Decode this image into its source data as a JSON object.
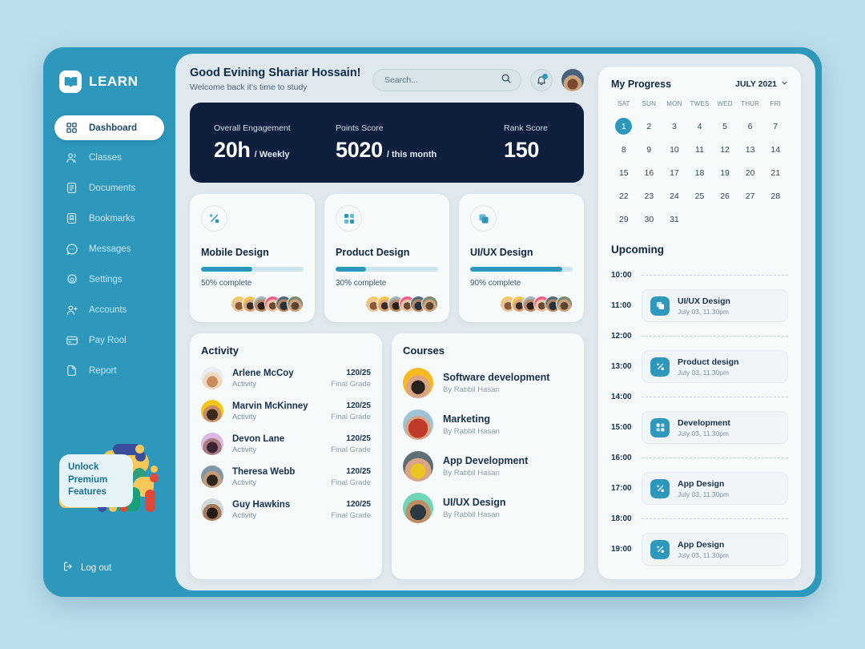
{
  "brand": {
    "name": "LEARN",
    "logo_icon": "book-icon"
  },
  "sidebar": {
    "items": [
      {
        "label": "Dashboard",
        "icon": "grid-icon",
        "active": true
      },
      {
        "label": "Classes",
        "icon": "users-icon",
        "active": false
      },
      {
        "label": "Documents",
        "icon": "document-icon",
        "active": false
      },
      {
        "label": "Bookmarks",
        "icon": "bookmark-icon",
        "active": false
      },
      {
        "label": "Messages",
        "icon": "message-icon",
        "active": false
      },
      {
        "label": "Settings",
        "icon": "gear-icon",
        "active": false
      },
      {
        "label": "Accounts",
        "icon": "user-add-icon",
        "active": false
      },
      {
        "label": "Pay Rool",
        "icon": "card-icon",
        "active": false
      },
      {
        "label": "Report",
        "icon": "report-icon",
        "active": false
      }
    ],
    "promo": {
      "line1": "Unlock",
      "line2": "Premium",
      "line3": "Features"
    },
    "logout": {
      "label": "Log out",
      "icon": "logout-icon"
    }
  },
  "header": {
    "greeting": "Good Evining Shariar Hossain!",
    "subtitle": "Welcome back it's time to study",
    "search": {
      "placeholder": "Search...",
      "value": "",
      "icon": "search-icon"
    },
    "bell": {
      "icon": "bell-icon",
      "has_notification": true
    },
    "avatar": {
      "name": "user-avatar"
    }
  },
  "stats": [
    {
      "label": "Overall Engagement",
      "value": "20h",
      "unit": "/ Weekly"
    },
    {
      "label": "Points Score",
      "value": "5020",
      "unit": "/ this month"
    },
    {
      "label": "Rank Score",
      "value": "150",
      "unit": ""
    }
  ],
  "course_cards": [
    {
      "title": "Mobile Design",
      "percent": 50,
      "progress_label": "50% complete",
      "icon": "scissors-node-icon"
    },
    {
      "title": "Product Design",
      "percent": 30,
      "progress_label": "30% complete",
      "icon": "four-squares-icon"
    },
    {
      "title": "UI/UX Design",
      "percent": 90,
      "progress_label": "90% complete",
      "icon": "layers-icon"
    }
  ],
  "activity": {
    "title": "Activity",
    "rows": [
      {
        "name": "Arlene McCoy",
        "sub": "Activity",
        "grade": "120/25",
        "grade_label": "Final Grade"
      },
      {
        "name": "Marvin McKinney",
        "sub": "Activity",
        "grade": "120/25",
        "grade_label": "Final Grade"
      },
      {
        "name": "Devon Lane",
        "sub": "Activity",
        "grade": "120/25",
        "grade_label": "Final Grade"
      },
      {
        "name": "Theresa Webb",
        "sub": "Activity",
        "grade": "120/25",
        "grade_label": "Final Grade"
      },
      {
        "name": "Guy Hawkins",
        "sub": "Activity",
        "grade": "120/25",
        "grade_label": "Final Grade"
      }
    ]
  },
  "courses": {
    "title": "Courses",
    "rows": [
      {
        "name": "Software development",
        "by": "By Rabbil Hasan"
      },
      {
        "name": "Marketing",
        "by": "By Rabbil Hasan"
      },
      {
        "name": "App Development",
        "by": "By Rabbil Hasan"
      },
      {
        "name": "UI/UX Design",
        "by": "By Rabbil Hasan"
      }
    ]
  },
  "progress": {
    "title": "My Progress",
    "month": "JULY 2021",
    "month_icon": "chevron-down-icon",
    "dow": [
      "SAT",
      "SUN",
      "MON",
      "TWES",
      "WED",
      "THUR",
      "FRI"
    ],
    "days": [
      1,
      2,
      3,
      4,
      5,
      6,
      7,
      8,
      9,
      10,
      11,
      12,
      13,
      14,
      15,
      16,
      17,
      18,
      19,
      20,
      21,
      22,
      23,
      24,
      25,
      26,
      27,
      28,
      29,
      30,
      31
    ],
    "selected_day": 1
  },
  "upcoming": {
    "title": "Upcoming",
    "slots": [
      {
        "time": "10:00",
        "event": null
      },
      {
        "time": "11:00",
        "event": {
          "name": "UI/UX Design",
          "date": "July 03, 11.30pm",
          "icon": "layers-icon"
        }
      },
      {
        "time": "12:00",
        "event": null
      },
      {
        "time": "13:00",
        "event": {
          "name": "Product design",
          "date": "July 03, 11.30pm",
          "icon": "scissors-node-icon"
        }
      },
      {
        "time": "14:00",
        "event": null
      },
      {
        "time": "15:00",
        "event": {
          "name": "Development",
          "date": "July 03, 11.30pm",
          "icon": "four-squares-icon"
        }
      },
      {
        "time": "16:00",
        "event": null
      },
      {
        "time": "17:00",
        "event": {
          "name": "App Design",
          "date": "July 03, 11.30pm",
          "icon": "scissors-node-icon"
        }
      },
      {
        "time": "18:00",
        "event": null
      },
      {
        "time": "19:00",
        "event": {
          "name": "App Design",
          "date": "July 03, 11.30pm",
          "icon": "scissors-node-icon"
        }
      }
    ]
  },
  "colors": {
    "page_bg": "#bcdfec",
    "sidebar": "#2e98bc",
    "main_bg": "#dfe9ed",
    "card_bg": "#f6fafb",
    "stats_bg": "#0d1f3c",
    "accent": "#2e98bc",
    "text_dark": "#10263f"
  }
}
